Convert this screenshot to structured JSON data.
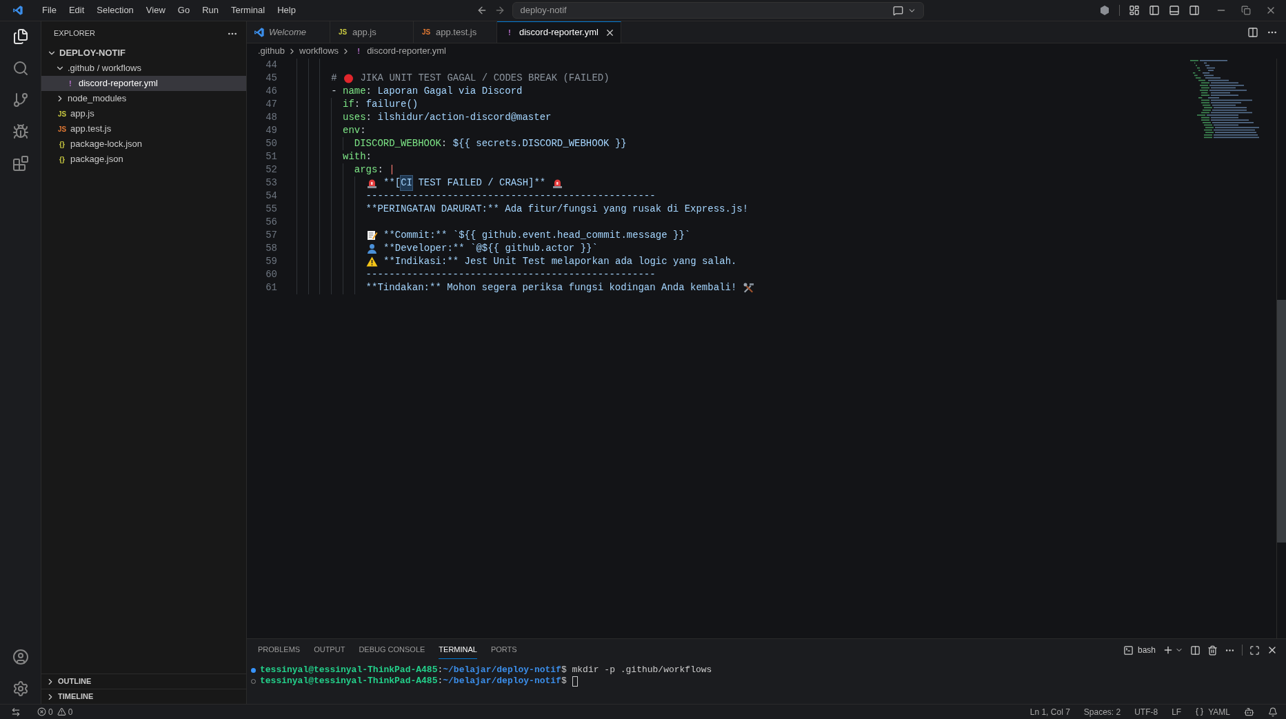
{
  "title_bar": {
    "menu": [
      "File",
      "Edit",
      "Selection",
      "View",
      "Go",
      "Run",
      "Terminal",
      "Help"
    ],
    "search": {
      "value": "deploy-notif"
    }
  },
  "sidebar": {
    "title": "EXPLORER",
    "tree": [
      {
        "label": "DEPLOY-NOTIF",
        "kind": "root",
        "expanded": true,
        "selected": false,
        "children": [
          {
            "label": ".github / workflows",
            "kind": "folder",
            "expanded": true,
            "selected": false,
            "children": [
              {
                "label": "discord-reporter.yml",
                "kind": "yaml",
                "icon": "!",
                "selected": true
              }
            ]
          },
          {
            "label": "node_modules",
            "kind": "folder",
            "expanded": false,
            "selected": false
          },
          {
            "label": "app.js",
            "kind": "js",
            "icon": "JS",
            "selected": false
          },
          {
            "label": "app.test.js",
            "kind": "test",
            "icon": "JS",
            "selected": false
          },
          {
            "label": "package-lock.json",
            "kind": "json",
            "icon": "{}",
            "selected": false
          },
          {
            "label": "package.json",
            "kind": "json",
            "icon": "{}",
            "selected": false
          }
        ]
      }
    ],
    "sections": [
      {
        "label": "OUTLINE",
        "expanded": false
      },
      {
        "label": "TIMELINE",
        "expanded": false
      }
    ]
  },
  "tabs": [
    {
      "label": "Welcome",
      "kind": "welcome",
      "selected": false
    },
    {
      "label": "app.js",
      "kind": "js",
      "icon": "JS",
      "selected": false
    },
    {
      "label": "app.test.js",
      "kind": "test",
      "icon": "JS",
      "selected": false
    },
    {
      "label": "discord-reporter.yml",
      "kind": "yaml",
      "icon": "!",
      "selected": true
    }
  ],
  "breadcrumb": [
    {
      "label": ".github"
    },
    {
      "label": "workflows"
    },
    {
      "label": "discord-reporter.yml",
      "kind": "yaml",
      "icon": "!"
    }
  ],
  "editor": {
    "lines": [
      {
        "number": "44"
      },
      {
        "number": "45",
        "tokens": [
          {
            "kind": "comment",
            "text": "# "
          },
          {
            "kind": "dot"
          },
          {
            "kind": "comment",
            "text": " JIKA UNIT TEST GAGAL / CODES BREAK (FAILED)"
          }
        ]
      },
      {
        "number": "46",
        "tokens": [
          {
            "kind": "punct",
            "text": "- "
          },
          {
            "kind": "key",
            "text": "name"
          },
          {
            "kind": "punct",
            "text": ": "
          },
          {
            "kind": "string",
            "text": "Laporan Gagal via Discord"
          }
        ],
        "children": [
          {
            "number": "47",
            "tokens": [
              {
                "kind": "key",
                "text": "if"
              },
              {
                "kind": "punct",
                "text": ": "
              },
              {
                "kind": "string",
                "text": "failure()"
              }
            ]
          },
          {
            "number": "48",
            "tokens": [
              {
                "kind": "key",
                "text": "uses"
              },
              {
                "kind": "punct",
                "text": ": "
              },
              {
                "kind": "string",
                "text": "ilshidur/action-discord@master"
              }
            ]
          },
          {
            "number": "49",
            "tokens": [
              {
                "kind": "key",
                "text": "env"
              },
              {
                "kind": "punct",
                "text": ":"
              }
            ],
            "children": [
              {
                "number": "50",
                "tokens": [
                  {
                    "kind": "key",
                    "text": "DISCORD_WEBHOOK"
                  },
                  {
                    "kind": "punct",
                    "text": ": "
                  },
                  {
                    "kind": "string",
                    "text": "${{ secrets.DISCORD_WEBHOOK }}"
                  }
                ]
              }
            ]
          },
          {
            "number": "51",
            "tokens": [
              {
                "kind": "key",
                "text": "with"
              },
              {
                "kind": "punct",
                "text": ":"
              }
            ],
            "children": [
              {
                "number": "52",
                "tokens": [
                  {
                    "kind": "key",
                    "text": "args"
                  },
                  {
                    "kind": "punct",
                    "text": ": "
                  },
                  {
                    "kind": "operator",
                    "text": "|"
                  }
                ],
                "children": [
                  {
                    "number": "53",
                    "tokens": [
                      {
                        "kind": "siren"
                      },
                      {
                        "kind": "string",
                        "text": " **["
                      },
                      {
                        "kind": "match",
                        "text": "CI"
                      },
                      {
                        "kind": "string",
                        "text": " TEST FAILED / CRASH]** "
                      },
                      {
                        "kind": "siren"
                      }
                    ]
                  },
                  {
                    "number": "54",
                    "tokens": [
                      {
                        "kind": "string",
                        "text": "--------------------------------------------------"
                      }
                    ]
                  },
                  {
                    "number": "55",
                    "tokens": [
                      {
                        "kind": "string",
                        "text": "**PERINGATAN DARURAT:** Ada fitur/fungsi yang rusak di Express.js!"
                      }
                    ]
                  },
                  {
                    "number": "56"
                  },
                  {
                    "number": "57",
                    "tokens": [
                      {
                        "kind": "memo"
                      },
                      {
                        "kind": "string",
                        "text": " **Commit:** `${{ github.event.head_commit.message }}`"
                      }
                    ]
                  },
                  {
                    "number": "58",
                    "tokens": [
                      {
                        "kind": "person"
                      },
                      {
                        "kind": "string",
                        "text": " **Developer:** `@${{ github.actor }}`"
                      }
                    ]
                  },
                  {
                    "number": "59",
                    "tokens": [
                      {
                        "kind": "warning"
                      },
                      {
                        "kind": "string",
                        "text": " **Indikasi:** Jest Unit Test melaporkan ada logic yang salah."
                      }
                    ]
                  },
                  {
                    "number": "60",
                    "tokens": [
                      {
                        "kind": "string",
                        "text": "--------------------------------------------------"
                      }
                    ]
                  },
                  {
                    "number": "61",
                    "tokens": [
                      {
                        "kind": "string",
                        "text": "**Tindakan:** Mohon segera periksa fungsi kodingan Anda kembali! "
                      },
                      {
                        "kind": "tools"
                      }
                    ]
                  }
                ]
              }
            ]
          }
        ]
      }
    ]
  },
  "panel": {
    "tabs": [
      {
        "label": "PROBLEMS",
        "selected": false
      },
      {
        "label": "OUTPUT",
        "selected": false
      },
      {
        "label": "DEBUG CONSOLE",
        "selected": false
      },
      {
        "label": "TERMINAL",
        "selected": true
      },
      {
        "label": "PORTS",
        "selected": false
      }
    ],
    "shell": "bash",
    "terminal": [
      {
        "succeeded": true,
        "user": "tessinyal@tessinyal-ThinkPad-A485",
        "separator": ":",
        "path": "~/belajar/deploy-notif",
        "prompt": "$",
        "command": " mkdir -p .github/workflows"
      },
      {
        "succeeded": false,
        "user": "tessinyal@tessinyal-ThinkPad-A485",
        "separator": ":",
        "path": "~/belajar/deploy-notif",
        "prompt": "$",
        "cursor": true
      }
    ]
  },
  "status_bar": {
    "errors": "0",
    "warnings": "0",
    "position": "Ln 1, Col 7",
    "spaces": "Spaces: 2",
    "encoding": "UTF-8",
    "eol": "LF",
    "language": "YAML"
  }
}
